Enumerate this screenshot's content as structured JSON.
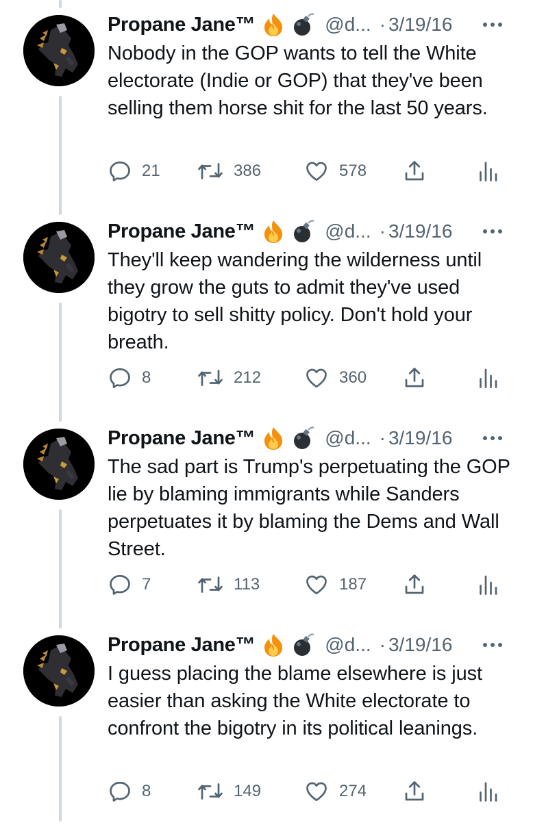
{
  "tweets": [
    {
      "name": "Propane Jane™",
      "handle": "@d...",
      "separator": "·",
      "date": "3/19/16",
      "text": "Nobody in the GOP wants to tell the White electorate (Indie or GOP) that they've been selling them horse shit for the last 50 years.",
      "replies": "21",
      "retweets": "386",
      "likes": "578"
    },
    {
      "name": "Propane Jane™",
      "handle": "@d...",
      "separator": "·",
      "date": "3/19/16",
      "text": "They'll keep wandering the wilderness until they grow the guts to admit they've used bigotry to sell shitty policy. Don't hold your breath.",
      "replies": "8",
      "retweets": "212",
      "likes": "360"
    },
    {
      "name": "Propane Jane™",
      "handle": "@d...",
      "separator": "·",
      "date": "3/19/16",
      "text": "The sad part is Trump's perpetuating the GOP lie by blaming immigrants while Sanders perpetuates it by blaming the Dems and Wall Street.",
      "replies": "7",
      "retweets": "113",
      "likes": "187"
    },
    {
      "name": "Propane Jane™",
      "handle": "@d...",
      "separator": "·",
      "date": "3/19/16",
      "text": "I guess placing the blame elsewhere is just easier than asking the White electorate to confront the bigotry in its political leanings.",
      "replies": "8",
      "retweets": "149",
      "likes": "274"
    }
  ],
  "icons": {
    "name_emojis": [
      "fire-emoji",
      "bomb-emoji"
    ],
    "actions": [
      "reply-icon",
      "retweet-icon",
      "like-icon",
      "share-icon",
      "analytics-icon"
    ],
    "more": "more-dots-icon"
  },
  "colors": {
    "text": "#0f1419",
    "muted": "#536471",
    "thread_line": "#cfd9de",
    "fire": "#f4900c"
  }
}
